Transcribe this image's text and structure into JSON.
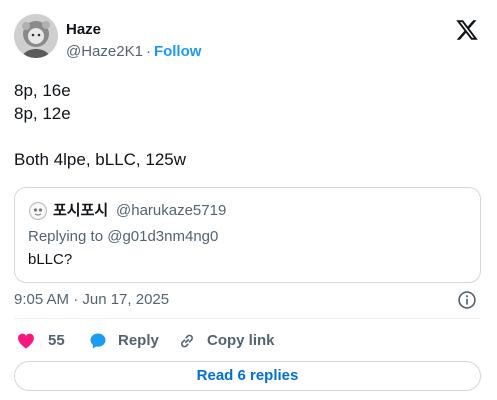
{
  "author": {
    "name": "Haze",
    "handle": "@Haze2K1",
    "separator": "·",
    "follow_label": "Follow"
  },
  "tweet": {
    "text": "8p, 16e\n8p, 12e\n\nBoth 4lpe, bLLC, 125w"
  },
  "quote": {
    "name": "포시포시",
    "handle": "@harukaze5719",
    "replying_to": "Replying to @g01d3nm4ng0",
    "text": "bLLC?"
  },
  "meta": {
    "timestamp": "9:05 AM · Jun 17, 2025"
  },
  "actions": {
    "like_count": "55",
    "reply_label": "Reply",
    "copy_label": "Copy link"
  },
  "read_replies_label": "Read 6 replies",
  "colors": {
    "accent": "#1d9bf0",
    "link": "#006fd6",
    "like": "#f91880",
    "reply_icon": "#1d9bf0",
    "text_secondary": "#536471",
    "border": "#cfd9de"
  },
  "icons": {
    "brand": "x-logo-icon",
    "info": "info-icon",
    "like": "heart-icon",
    "reply": "speech-bubble-icon",
    "copy": "link-icon"
  }
}
